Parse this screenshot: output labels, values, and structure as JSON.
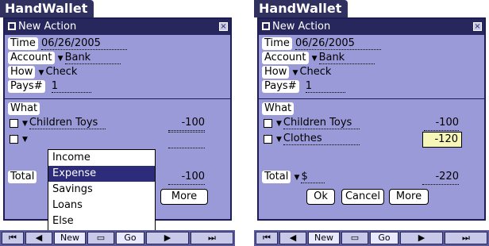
{
  "screens": [
    {
      "app_title": "HandWallet",
      "form_title": "New Action",
      "fields": {
        "time_label": "Time",
        "time_value": "06/26/2005",
        "account_label": "Account",
        "account_value": "Bank",
        "how_label": "How",
        "how_value": "Check",
        "pays_label": "Pays#",
        "pays_value": "1"
      },
      "what_label": "What",
      "items": [
        {
          "name": "Children Toys",
          "amount": "-100"
        },
        {
          "name": "",
          "amount": ""
        }
      ],
      "dropdown": {
        "options": [
          "Income",
          "Expense",
          "Savings",
          "Loans",
          "Else"
        ],
        "selected": "Expense"
      },
      "total_label": "Total",
      "total_amount": "-100",
      "buttons": {
        "more": "More"
      },
      "nav": {
        "new": "New",
        "go": "Go"
      }
    },
    {
      "app_title": "HandWallet",
      "form_title": "New Action",
      "fields": {
        "time_label": "Time",
        "time_value": "06/26/2005",
        "account_label": "Account",
        "account_value": "Bank",
        "how_label": "How",
        "how_value": "Check",
        "pays_label": "Pays#",
        "pays_value": "1"
      },
      "what_label": "What",
      "items": [
        {
          "name": "Children Toys",
          "amount": "-100"
        },
        {
          "name": "Clothes",
          "amount": "-120"
        }
      ],
      "total_label": "Total",
      "total_currency": "$",
      "total_amount": "-220",
      "buttons": {
        "ok": "Ok",
        "cancel": "Cancel",
        "more": "More"
      },
      "nav": {
        "new": "New",
        "go": "Go"
      }
    }
  ],
  "colors": {
    "form_bg": "#9a9ad8",
    "title_bg": "#27275e",
    "selected_bg": "#2c2c7a",
    "edit_bg": "#f6f6b8"
  }
}
